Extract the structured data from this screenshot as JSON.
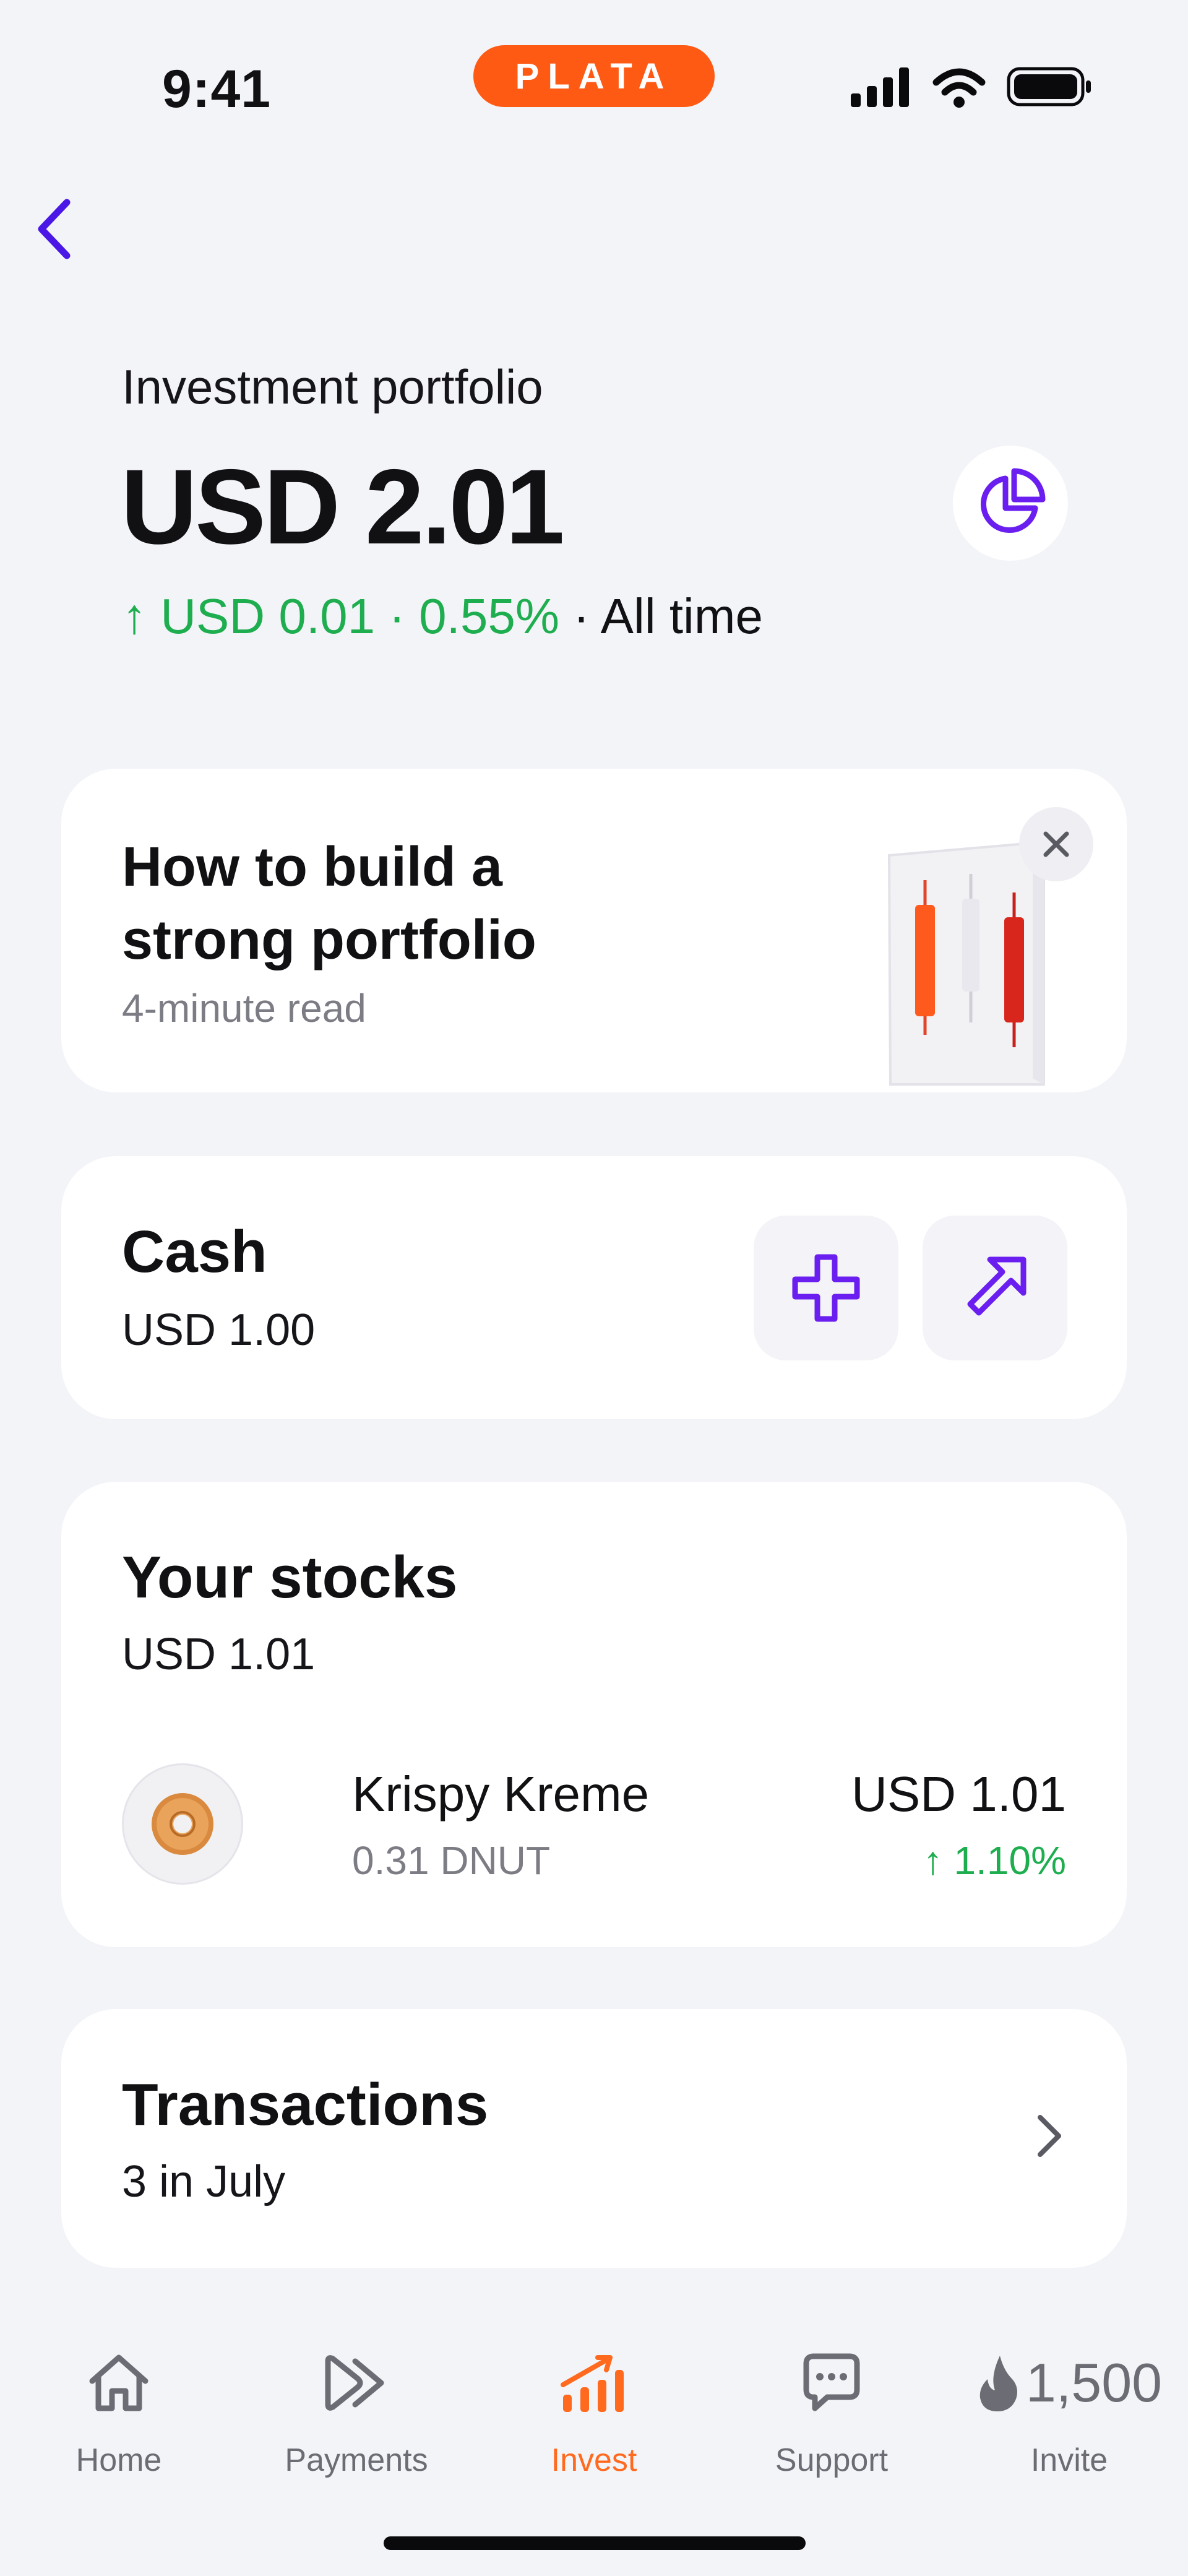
{
  "status_bar": {
    "time": "9:41",
    "brand": "PLATA"
  },
  "header": {
    "title": "Investment portfolio",
    "total_value": "USD 2.01",
    "change_amount": "↑ USD 0.01 · 0.55%",
    "change_period": " · All time"
  },
  "promo": {
    "title": "How to build a strong portfolio",
    "subtitle": "4-minute read"
  },
  "cash": {
    "title": "Cash",
    "amount": "USD 1.00"
  },
  "stocks": {
    "title": "Your stocks",
    "total": "USD 1.01",
    "items": [
      {
        "name": "Krispy Kreme",
        "quantity": "0.31 DNUT",
        "value": "USD 1.01",
        "change": "↑ 1.10%"
      }
    ]
  },
  "transactions": {
    "title": "Transactions",
    "subtitle": "3 in July"
  },
  "tab_bar": {
    "tabs": [
      {
        "label": "Home",
        "icon": "home-icon"
      },
      {
        "label": "Payments",
        "icon": "payments-icon"
      },
      {
        "label": "Invest",
        "icon": "invest-icon"
      },
      {
        "label": "Support",
        "icon": "support-icon"
      },
      {
        "label": "Invite",
        "icon": "flame-icon"
      }
    ],
    "invite_count": "1,500",
    "active": "Invest"
  },
  "colors": {
    "accent": "#6a1ff0",
    "brand": "#ff5a14",
    "positive": "#1fae4f",
    "active_tab": "#ff6a1f"
  }
}
